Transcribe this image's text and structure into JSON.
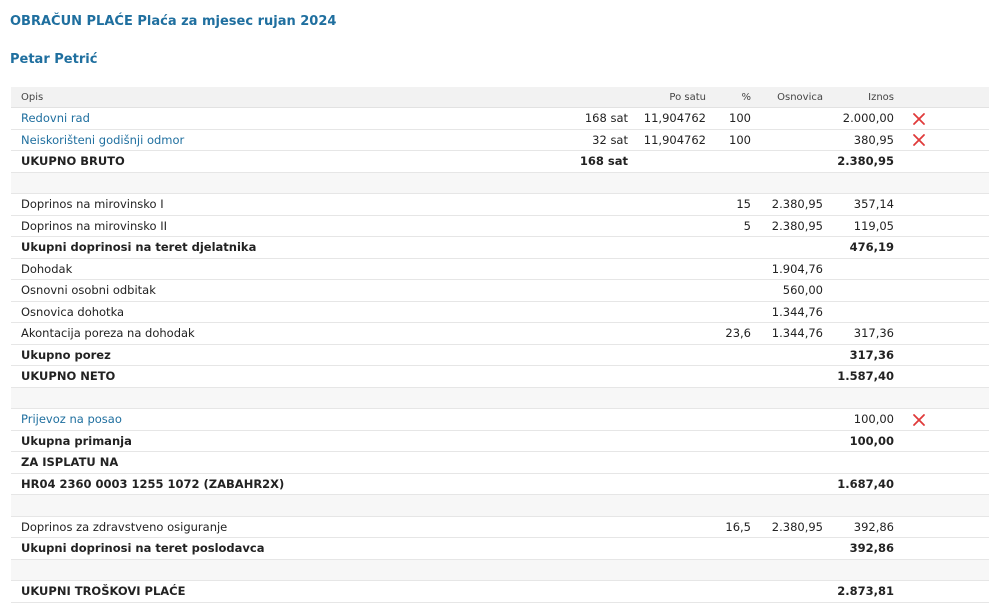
{
  "title": "OBRAČUN PLAĆE Plaća za mjesec rujan 2024",
  "employee": "Petar Petrić",
  "columns": {
    "desc": "Opis",
    "rate": "Po satu",
    "pct": "%",
    "base": "Osnovica",
    "amount": "Iznos"
  },
  "rows": [
    {
      "type": "item",
      "link": true,
      "deletable": true,
      "desc": "Redovni rad",
      "qty": "168 sat",
      "rate": "11,904762",
      "pct": "100",
      "base": "",
      "amount": "2.000,00"
    },
    {
      "type": "item",
      "link": true,
      "deletable": true,
      "desc": "Neiskorišteni godišnji odmor",
      "qty": "32 sat",
      "rate": "11,904762",
      "pct": "100",
      "base": "",
      "amount": "380,95"
    },
    {
      "type": "total",
      "desc": "UKUPNO BRUTO",
      "qty": "168 sat",
      "rate": "",
      "pct": "",
      "base": "",
      "amount": "2.380,95"
    },
    {
      "type": "spacer"
    },
    {
      "type": "item",
      "desc": "Doprinos na mirovinsko I",
      "qty": "",
      "rate": "",
      "pct": "15",
      "base": "2.380,95",
      "amount": "357,14"
    },
    {
      "type": "item",
      "desc": "Doprinos na mirovinsko II",
      "qty": "",
      "rate": "",
      "pct": "5",
      "base": "2.380,95",
      "amount": "119,05"
    },
    {
      "type": "total",
      "desc": "Ukupni doprinosi na teret djelatnika",
      "qty": "",
      "rate": "",
      "pct": "",
      "base": "",
      "amount": "476,19"
    },
    {
      "type": "item",
      "desc": "Dohodak",
      "qty": "",
      "rate": "",
      "pct": "",
      "base": "1.904,76",
      "amount": ""
    },
    {
      "type": "item",
      "desc": "Osnovni osobni odbitak",
      "qty": "",
      "rate": "",
      "pct": "",
      "base": "560,00",
      "amount": ""
    },
    {
      "type": "item",
      "desc": "Osnovica dohotka",
      "qty": "",
      "rate": "",
      "pct": "",
      "base": "1.344,76",
      "amount": ""
    },
    {
      "type": "item",
      "desc": "Akontacija poreza na dohodak",
      "qty": "",
      "rate": "",
      "pct": "23,6",
      "base": "1.344,76",
      "amount": "317,36"
    },
    {
      "type": "total",
      "desc": "Ukupno porez",
      "qty": "",
      "rate": "",
      "pct": "",
      "base": "",
      "amount": "317,36"
    },
    {
      "type": "total",
      "desc": "UKUPNO NETO",
      "qty": "",
      "rate": "",
      "pct": "",
      "base": "",
      "amount": "1.587,40"
    },
    {
      "type": "spacer"
    },
    {
      "type": "item",
      "link": true,
      "deletable": true,
      "desc": "Prijevoz na posao",
      "qty": "",
      "rate": "",
      "pct": "",
      "base": "",
      "amount": "100,00"
    },
    {
      "type": "total",
      "desc": "Ukupna primanja",
      "qty": "",
      "rate": "",
      "pct": "",
      "base": "",
      "amount": "100,00"
    },
    {
      "type": "total",
      "desc": "ZA ISPLATU NA",
      "qty": "",
      "rate": "",
      "pct": "",
      "base": "",
      "amount": ""
    },
    {
      "type": "total",
      "desc": "HR04 2360 0003 1255 1072 (ZABAHR2X)",
      "qty": "",
      "rate": "",
      "pct": "",
      "base": "",
      "amount": "1.687,40"
    },
    {
      "type": "spacer"
    },
    {
      "type": "item",
      "desc": "Doprinos za zdravstveno osiguranje",
      "qty": "",
      "rate": "",
      "pct": "16,5",
      "base": "2.380,95",
      "amount": "392,86"
    },
    {
      "type": "total",
      "desc": "Ukupni doprinosi na teret poslodavca",
      "qty": "",
      "rate": "",
      "pct": "",
      "base": "",
      "amount": "392,86"
    },
    {
      "type": "spacer"
    },
    {
      "type": "total",
      "desc": "UKUPNI TROŠKOVI PLAĆE",
      "qty": "",
      "rate": "",
      "pct": "",
      "base": "",
      "amount": "2.873,81"
    }
  ],
  "icons": {
    "delete": "close-x-icon"
  },
  "colors": {
    "title": "#1f6f9f",
    "link": "#1f6f9f",
    "delete": "#e03a3a",
    "header_bg": "#f2f2f2"
  }
}
